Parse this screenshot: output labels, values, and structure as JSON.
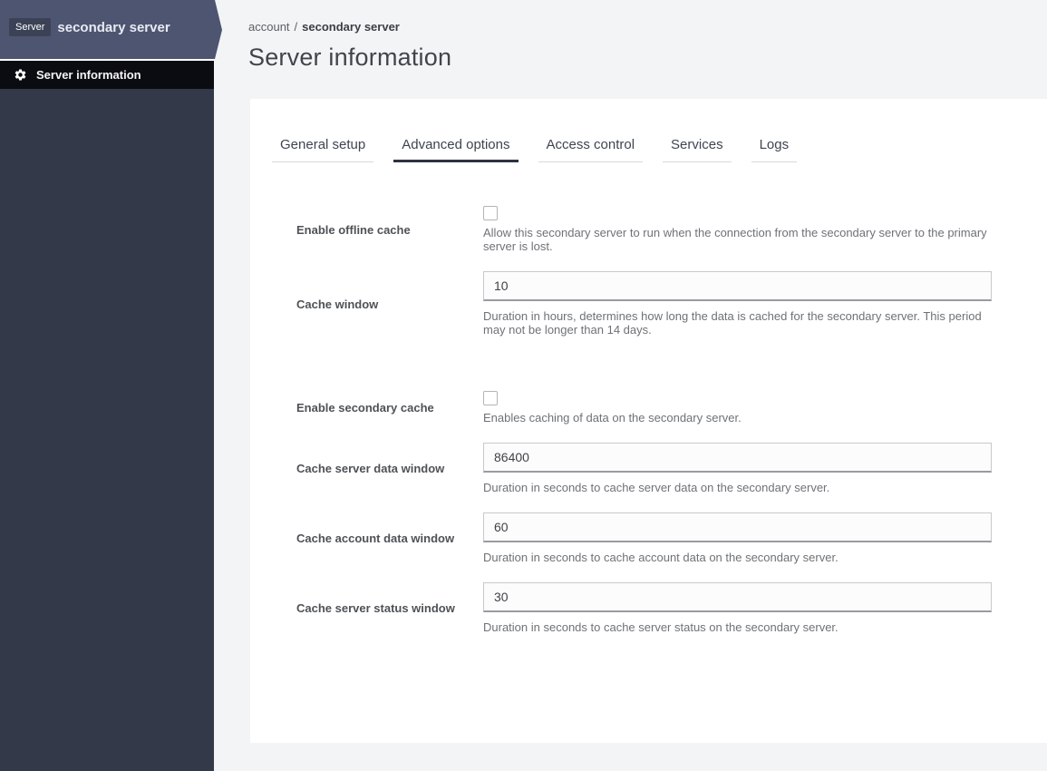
{
  "sidebar": {
    "badge": "Server",
    "title": "secondary server",
    "menu_item": {
      "icon": "gear",
      "label": "Server information"
    }
  },
  "breadcrumb": {
    "parent": "account",
    "separator": "/",
    "current": "secondary server"
  },
  "page": {
    "title": "Server information"
  },
  "tabs": [
    {
      "label": "General setup",
      "active": false
    },
    {
      "label": "Advanced options",
      "active": true
    },
    {
      "label": "Access control",
      "active": false
    },
    {
      "label": "Services",
      "active": false
    },
    {
      "label": "Logs",
      "active": false
    }
  ],
  "form": {
    "sections": [
      {
        "fields": [
          {
            "name": "enable-offline-cache",
            "type": "checkbox",
            "label": "Enable offline cache",
            "checked": false,
            "help": "Allow this secondary server to run when the connection from the secondary server to the primary server is lost."
          },
          {
            "name": "cache-window",
            "type": "text",
            "label": "Cache window",
            "value": "10",
            "help": "Duration in hours, determines how long the data is cached for the secondary server. This period may not be longer than 14 days."
          }
        ]
      },
      {
        "fields": [
          {
            "name": "enable-secondary-cache",
            "type": "checkbox",
            "label": "Enable secondary cache",
            "checked": false,
            "help": "Enables caching of data on the secondary server."
          },
          {
            "name": "cache-server-data-window",
            "type": "text",
            "label": "Cache server data window",
            "value": "86400",
            "help": "Duration in seconds to cache server data on the secondary server."
          },
          {
            "name": "cache-account-data-window",
            "type": "text",
            "label": "Cache account data window",
            "value": "60",
            "help": "Duration in seconds to cache account data on the secondary server."
          },
          {
            "name": "cache-server-status-window",
            "type": "text",
            "label": "Cache server status window",
            "value": "30",
            "help": "Duration in seconds to cache server status on the secondary server."
          }
        ]
      }
    ]
  },
  "colors": {
    "sidebar_header": "#4d5571",
    "sidebar_badge": "#3b4255",
    "sidebar_body": "#333949",
    "sidebar_menu_bg": "#0b0c12",
    "active_tab_underline": "#2d3243",
    "page_background": "#f3f4f6",
    "card_background": "#ffffff"
  }
}
